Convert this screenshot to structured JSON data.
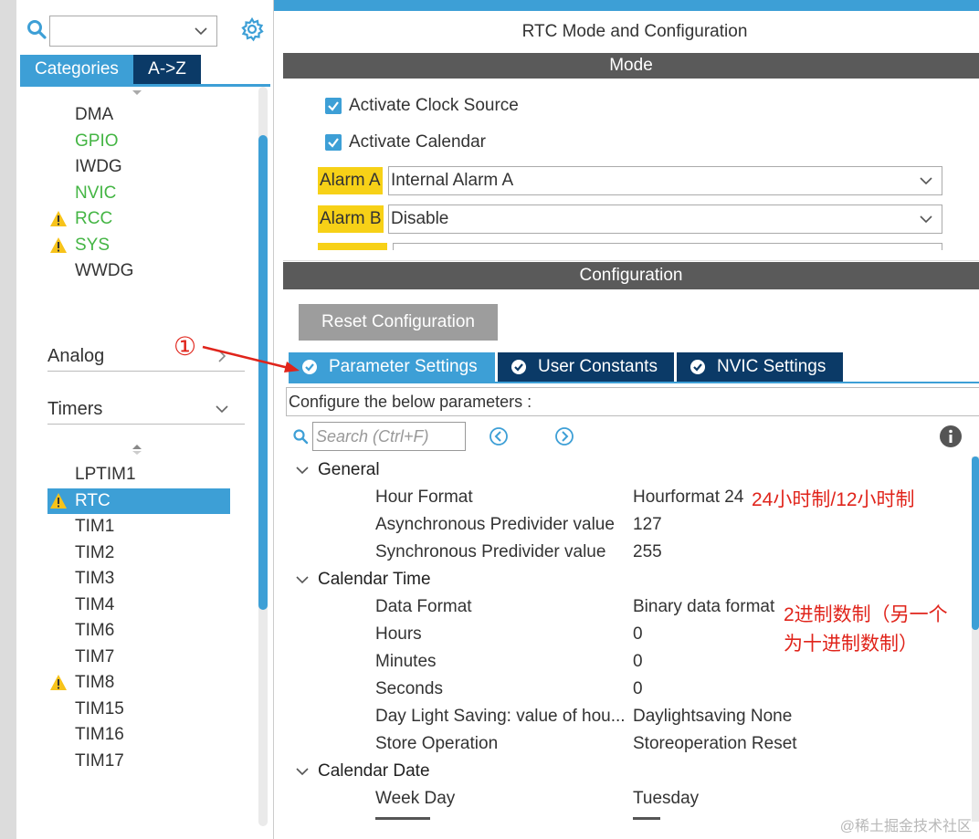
{
  "left": {
    "tabs": {
      "categories": "Categories",
      "az": "A->Z"
    },
    "system_items": [
      {
        "label": "DMA",
        "state": "normal"
      },
      {
        "label": "GPIO",
        "state": "green"
      },
      {
        "label": "IWDG",
        "state": "normal"
      },
      {
        "label": "NVIC",
        "state": "green"
      },
      {
        "label": "RCC",
        "state": "warning"
      },
      {
        "label": "SYS",
        "state": "warning"
      },
      {
        "label": "WWDG",
        "state": "normal"
      }
    ],
    "sections": {
      "analog": "Analog",
      "timers": "Timers"
    },
    "timer_items": [
      {
        "label": "LPTIM1",
        "state": "normal"
      },
      {
        "label": "RTC",
        "state": "warning-selected"
      },
      {
        "label": "TIM1",
        "state": "normal"
      },
      {
        "label": "TIM2",
        "state": "normal"
      },
      {
        "label": "TIM3",
        "state": "normal"
      },
      {
        "label": "TIM4",
        "state": "normal"
      },
      {
        "label": "TIM6",
        "state": "normal"
      },
      {
        "label": "TIM7",
        "state": "normal"
      },
      {
        "label": "TIM8",
        "state": "warning"
      },
      {
        "label": "TIM15",
        "state": "normal"
      },
      {
        "label": "TIM16",
        "state": "normal"
      },
      {
        "label": "TIM17",
        "state": "normal"
      }
    ]
  },
  "main": {
    "title": "RTC Mode and Configuration",
    "mode_header": "Mode",
    "activate_clock_source": "Activate Clock Source",
    "activate_calendar": "Activate Calendar",
    "alarm_a": {
      "label": "Alarm A",
      "value": "Internal Alarm A"
    },
    "alarm_b": {
      "label": "Alarm B",
      "value": "Disable"
    },
    "config_header": "Configuration",
    "reset_button": "Reset Configuration",
    "tabs": {
      "parameter": "Parameter Settings",
      "user": "User Constants",
      "nvic": "NVIC Settings"
    },
    "configure_text": "Configure the below parameters :",
    "search_placeholder": "Search (Ctrl+F)",
    "groups": {
      "general": "General",
      "calendar_time": "Calendar Time",
      "calendar_date": "Calendar Date"
    },
    "params": [
      {
        "name": "Hour Format",
        "value": "Hourformat 24"
      },
      {
        "name": "Asynchronous Predivider value",
        "value": "127"
      },
      {
        "name": "Synchronous Predivider value",
        "value": "255"
      },
      {
        "name": "Data Format",
        "value": "Binary data format"
      },
      {
        "name": "Hours",
        "value": "0"
      },
      {
        "name": "Minutes",
        "value": "0"
      },
      {
        "name": "Seconds",
        "value": "0"
      },
      {
        "name": "Day Light Saving: value of hou...",
        "value": "Daylightsaving None"
      },
      {
        "name": "Store Operation",
        "value": "Storeoperation Reset"
      },
      {
        "name": "Week Day",
        "value": "Tuesday"
      }
    ]
  },
  "annotations": {
    "circled_number": "①",
    "hour_note": "24小时制/12小时制",
    "data_note_line1": "2进制数制（另一个",
    "data_note_line2": "为十进制数制）"
  },
  "watermark": "@稀土掘金技术社区",
  "colors": {
    "accent_blue": "#3d9fd6",
    "dark_navy": "#0b3a67",
    "header_gray": "#5a5a5a",
    "highlight_yellow": "#f7d117",
    "annotation_red": "#e0241b",
    "green_item": "#44b544"
  }
}
